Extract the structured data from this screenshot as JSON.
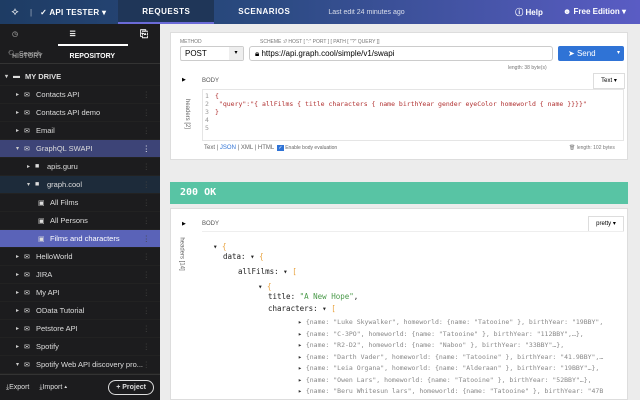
{
  "header": {
    "app": "API TESTER",
    "tabs": [
      "REQUESTS",
      "SCENARIOS"
    ],
    "last_edit": "Last edit 24 minutes ago",
    "help": "Help",
    "edition": "Free Edition"
  },
  "sidebar": {
    "tabs": [
      "HISTORY",
      "REPOSITORY"
    ],
    "search_placeholder": "Search",
    "root": "MY DRIVE",
    "items": [
      "Contacts API",
      "Contacts API demo",
      "Email",
      "GraphQL SWAPI",
      "apis.guru",
      "graph.cool",
      "All Films",
      "All Persons",
      "Films and characters",
      "HelloWorld",
      "JIRA",
      "My API",
      "OData Tutorial",
      "Petstore API",
      "Spotify",
      "Spotify Web API discovery pro..."
    ],
    "export": "Export",
    "import": "Import",
    "project": "Project"
  },
  "request": {
    "method_label": "METHOD",
    "method": "POST",
    "url_label": "SCHEME :// HOST [ \":\" PORT ] [ PATH [ \"?\" QUERY ]]",
    "url": "https://api.graph.cool/simple/v1/swapi",
    "url_length": "length: 38 byte(s)",
    "send": "Send",
    "body_label": "BODY",
    "headers_label": "headers [2]",
    "body_format": "Text",
    "body_lines": [
      "{",
      "  \"query\":\"{ allFilms { title characters { name birthYear gender eyeColor homeworld { name }}}}\"",
      "}",
      "",
      ""
    ],
    "formats": [
      "Text",
      "JSON",
      "XML",
      "HTML"
    ],
    "eval": "Enable body evaluation",
    "body_length": "length: 102 bytes"
  },
  "response": {
    "status": "200 OK",
    "body_label": "BODY",
    "headers_label": "headers [14]",
    "view": "pretty",
    "title": "\"A New Hope\"",
    "characters": [
      "{name: \"Luke Skywalker\", homeworld: {name: \"Tatooine\" }, birthYear: \"19BBY\",",
      "{name: \"C-3PO\", homeworld: {name: \"Tatooine\" }, birthYear: \"112BBY\",…},",
      "{name: \"R2-D2\", homeworld: {name: \"Naboo\" }, birthYear: \"33BBY\"…},",
      "{name: \"Darth Vader\", homeworld: {name: \"Tatooine\" }, birthYear: \"41.9BBY\",…",
      "{name: \"Leia Organa\", homeworld: {name: \"Alderaan\" }, birthYear: \"19BBY\"…},",
      "{name: \"Owen Lars\", homeworld: {name: \"Tatooine\" }, birthYear: \"52BBY\"…},",
      "{name: \"Beru Whitesun lars\", homeworld: {name: \"Tatooine\" }, birthYear: \"47B"
    ]
  }
}
